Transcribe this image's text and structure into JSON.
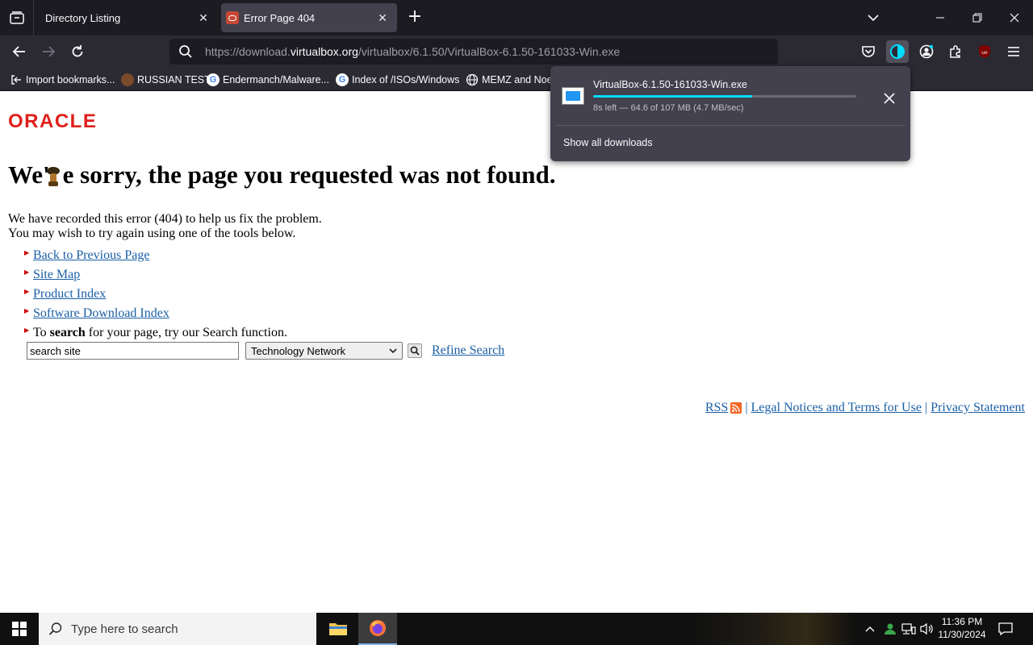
{
  "browser": {
    "tabs": [
      {
        "title": "Directory Listing"
      },
      {
        "title": "Error Page 404"
      }
    ],
    "url": {
      "prefix": "https://download.",
      "host": "virtualbox.org",
      "path": "/virtualbox/6.1.50/VirtualBox-6.1.50-161033-Win.exe"
    },
    "bookmarks": [
      {
        "label": "Import bookmarks..."
      },
      {
        "label": "RUSSIAN TEST"
      },
      {
        "label": "Endermanch/Malware..."
      },
      {
        "label": "Index of /ISOs/Windows"
      },
      {
        "label": "MEMZ and Noes"
      }
    ],
    "accent": "#00ddff"
  },
  "downloads": {
    "filename": "VirtualBox-6.1.50-161033-Win.exe",
    "status": "8s left — 64.6 of 107 MB (4.7 MB/sec)",
    "progress": 0.604,
    "show_all": "Show all downloads"
  },
  "page": {
    "logo": "ORACLE",
    "headline_a": "We'",
    "headline_b": "e sorry, the page you requested was not found.",
    "intro_line1": "We have recorded this error (404) to help us fix the problem.",
    "intro_line2": "You may wish to try again using one of the tools below.",
    "links": [
      "Back to Previous Page",
      "Site Map",
      "Product Index",
      "Software Download Index"
    ],
    "search_prefix": "To ",
    "search_bold": "search",
    "search_suffix": " for your page, try our Search function.",
    "search_value": "search site",
    "search_scope": "Technology Network",
    "refine": "Refine Search",
    "footer": {
      "rss": "RSS",
      "legal": "Legal Notices and Terms for Use",
      "privacy": "Privacy Statement"
    },
    "brand_color": "#e0201b"
  },
  "taskbar": {
    "search_placeholder": "Type here to search",
    "time": "11:36 PM",
    "date": "11/30/2024"
  }
}
